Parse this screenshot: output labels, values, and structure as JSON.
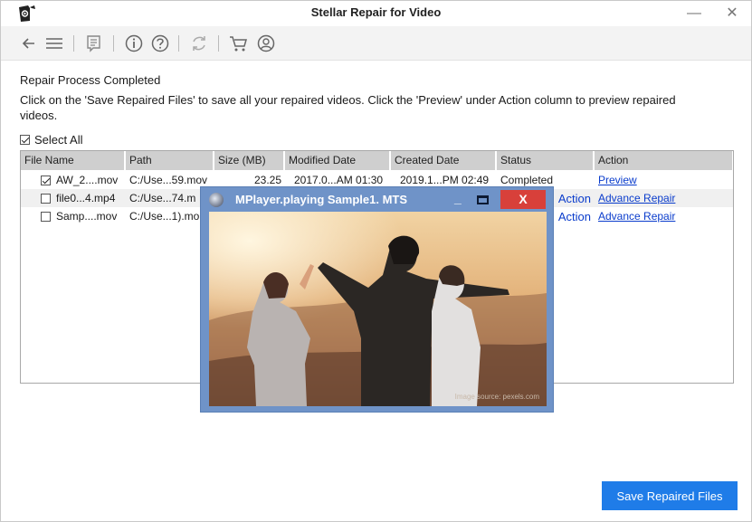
{
  "window": {
    "title": "Stellar Repair for Video"
  },
  "toolbar": {
    "icons": [
      "back-arrow-icon",
      "hamburger-menu-icon",
      "bookmark-icon",
      "info-icon",
      "help-icon",
      "refresh-icon",
      "cart-icon",
      "user-account-icon"
    ]
  },
  "main": {
    "heading": "Repair Process Completed",
    "description": "Click on the 'Save Repaired Files' to save all your repaired videos. Click the 'Preview' under Action column to preview repaired videos.",
    "select_all_label": "Select All",
    "select_all_checked": true
  },
  "table": {
    "columns": [
      "File Name",
      "Path",
      "Size (MB)",
      "Modified Date",
      "Created Date",
      "Status",
      "Action"
    ],
    "rows": [
      {
        "checked": true,
        "file_name": "AW_2....mov",
        "path": "C:/Use...59.mov",
        "size": "23.25",
        "modified": "2017.0...AM 01:30",
        "created": "2019.1...PM 02:49",
        "status": "Completed",
        "action": "Preview"
      },
      {
        "checked": false,
        "file_name": "file0...4.mp4",
        "path": "C:/Use...74.m",
        "size": "",
        "modified": "",
        "created": "",
        "status": "Action",
        "action": "Advance Repair"
      },
      {
        "checked": false,
        "file_name": "Samp....mov",
        "path": "C:/Use...1).mo",
        "size": "",
        "modified": "",
        "created": "",
        "status": "Action",
        "action": "Advance Repair"
      }
    ]
  },
  "player": {
    "title": "MPlayer.playing Sample1. MTS",
    "minimize_label": "_",
    "close_label": "X",
    "credit": "Image source: pexels.com"
  },
  "footer": {
    "save_label": "Save Repaired Files"
  },
  "colors": {
    "accent": "#1f7ce8",
    "link": "#0a3ccc",
    "player_frame": "#6f93c8",
    "close_red": "#d8403a"
  }
}
